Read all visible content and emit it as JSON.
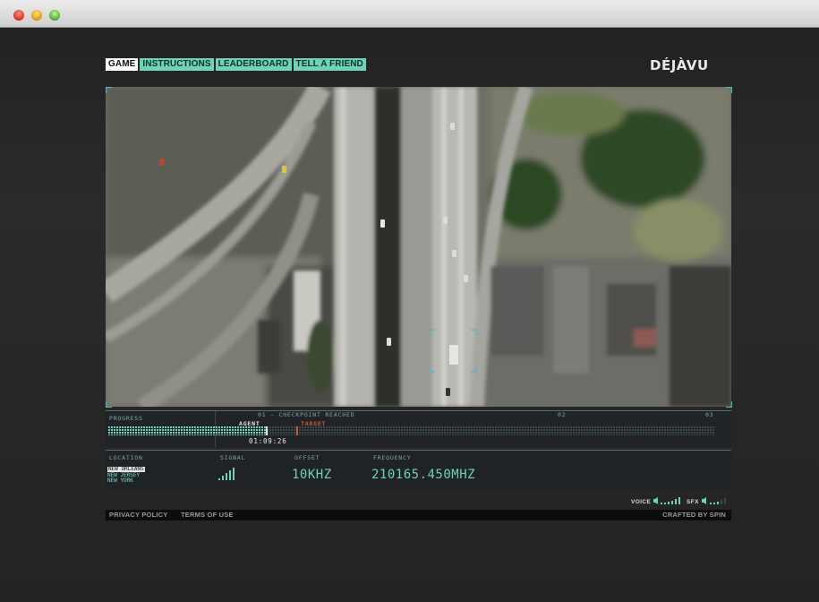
{
  "nav": {
    "items": [
      "GAME",
      "INSTRUCTIONS",
      "LEADERBOARD",
      "TELL A FRIEND"
    ],
    "active": "GAME"
  },
  "logo": "DÉJÀVU",
  "progress": {
    "label": "PROGRESS",
    "checkpoint": "01 - CHECKPOINT REACHED",
    "marker_02": "02",
    "marker_03": "03",
    "agent_label": "AGENT",
    "target_label": "TARGET",
    "timer": "01:09:26",
    "agent_progress": 0.26,
    "target_progress": 0.31
  },
  "status": {
    "location_label": "LOCATION",
    "locations": [
      "NEW ORLEANS",
      "NEW JERSEY",
      "NEW YORK"
    ],
    "signal_label": "SIGNAL",
    "offset_label": "OFFSET",
    "offset_value": "10KHZ",
    "frequency_label": "FREQUENCY",
    "frequency_value": "210165.450MHZ"
  },
  "audio": {
    "voice_label": "VOICE",
    "sfx_label": "SFX"
  },
  "footer": {
    "privacy": "PRIVACY POLICY",
    "terms": "TERMS OF USE",
    "credit": "CRAFTED BY SPIN"
  },
  "colors": {
    "accent": "#6fd3b9",
    "target": "#e0553d",
    "hud": "#4fb8c8"
  }
}
